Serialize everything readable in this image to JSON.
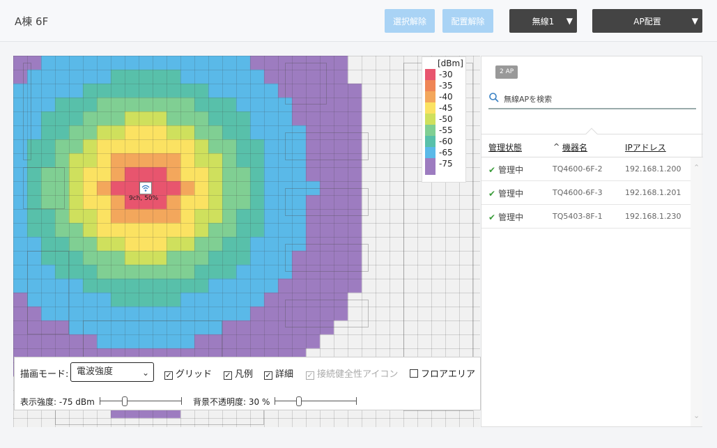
{
  "header": {
    "title": "A棟 6F",
    "buttons": {
      "deselect": "選択解除",
      "unplace": "配置解除",
      "radio": "無線1",
      "ap_place": "AP配置"
    },
    "caret": "▼"
  },
  "heatmap": {
    "ap_label": "9ch, 50%",
    "colors": {
      "c30": "#e8556e",
      "c35": "#ef8556",
      "c40": "#f3a75c",
      "c45": "#fbe262",
      "c50": "#cfe05d",
      "c55": "#80cf93",
      "c60": "#58c0aa",
      "c65": "#5ab9e8",
      "c75": "#9d7cc0"
    }
  },
  "legend": {
    "title": "[dBm]",
    "items": [
      {
        "label": "-30",
        "color": "#e8556e"
      },
      {
        "label": "-35",
        "color": "#ef8556"
      },
      {
        "label": "-40",
        "color": "#f3a75c"
      },
      {
        "label": "-45",
        "color": "#fbe262"
      },
      {
        "label": "-50",
        "color": "#cfe05d"
      },
      {
        "label": "-55",
        "color": "#80cf93"
      },
      {
        "label": "-60",
        "color": "#58c0aa"
      },
      {
        "label": "-65",
        "color": "#5ab9e8"
      },
      {
        "label": "-75",
        "color": "#9d7cc0"
      }
    ]
  },
  "controls": {
    "mode_label": "描画モード:",
    "mode_value": "電波強度",
    "grid": "グリッド",
    "legend": "凡例",
    "detail": "詳細",
    "health_icon": "接続健全性アイコン",
    "floor_area": "フロアエリア",
    "strength_label": "表示強度: -75 dBm",
    "opacity_label": "背景不透明度: 30 %",
    "strength_value": -75,
    "opacity_value": 30
  },
  "panel": {
    "badge": "2 AP",
    "search_placeholder": "無線APを検索",
    "columns": {
      "status": "管理状態",
      "sort_marker": "^",
      "name": "機器名",
      "ip": "IPアドレス"
    },
    "rows": [
      {
        "status": "管理中",
        "name": "TQ4600-6F-2",
        "ip": "192.168.1.200"
      },
      {
        "status": "管理中",
        "name": "TQ4600-6F-3",
        "ip": "192.168.1.201"
      },
      {
        "status": "管理中",
        "name": "TQ5403-8F-1",
        "ip": "192.168.1.230"
      }
    ]
  }
}
